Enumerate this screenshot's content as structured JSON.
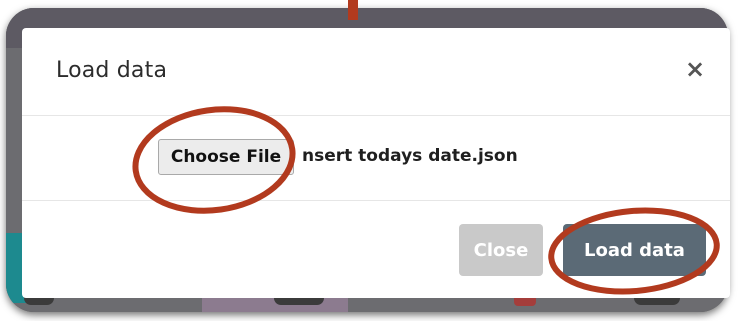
{
  "dialog": {
    "title": "Load data",
    "close_symbol": "×"
  },
  "file_input": {
    "button_label": "Choose File",
    "file_name": "nsert todays date.json"
  },
  "footer": {
    "close_label": "Close",
    "load_label": "Load data"
  },
  "annotations": {
    "color": "#b23a1e"
  }
}
